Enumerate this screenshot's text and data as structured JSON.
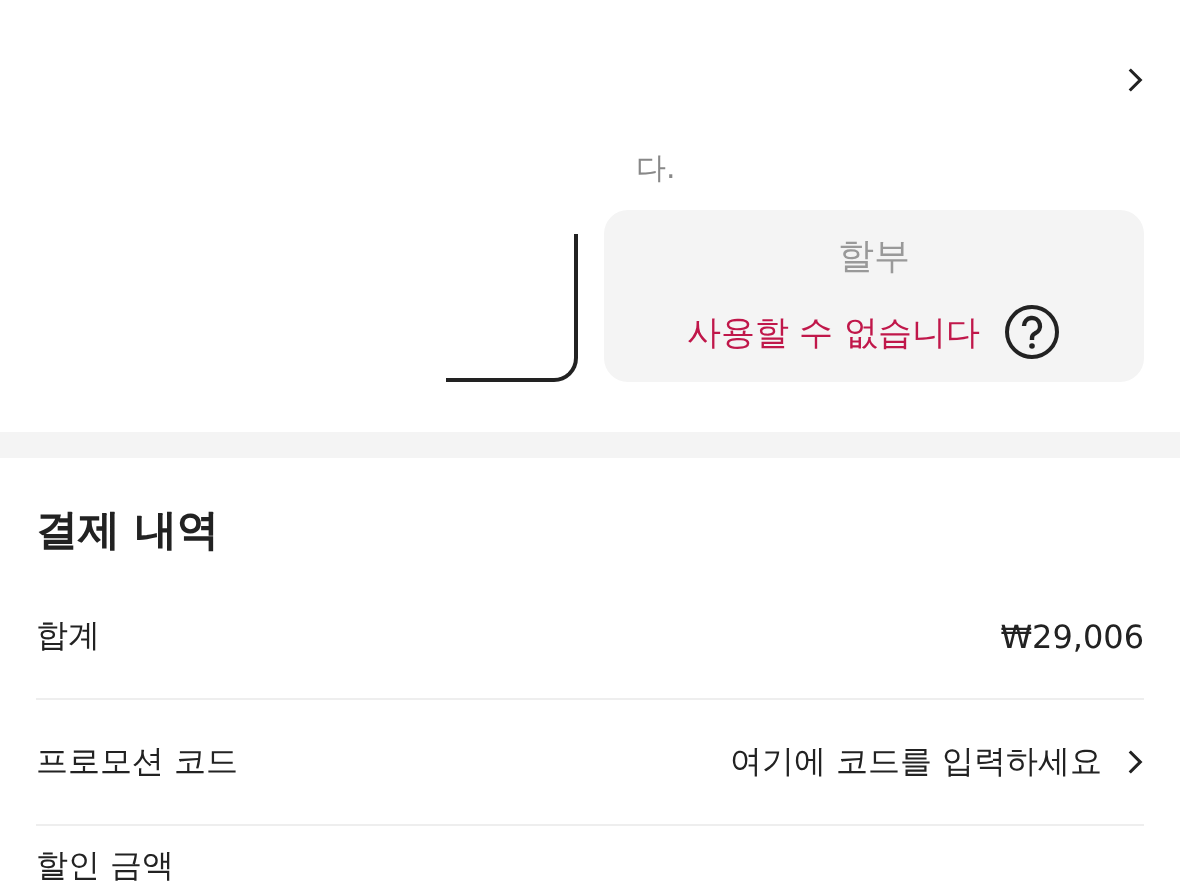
{
  "notice_text": "다.",
  "payment_options": [
    {
      "selected": true
    },
    {
      "label": "할부",
      "status": "사용할 수 없습니다",
      "selected": false
    }
  ],
  "summary": {
    "title": "결제 내역",
    "rows": [
      {
        "kind": "amount",
        "label": "합계",
        "value": "₩29,006"
      },
      {
        "kind": "link",
        "label": "프로모션 코드",
        "value": "여기에 코드를 입력하세요"
      },
      {
        "kind": "amount",
        "label": "할인 금액"
      }
    ]
  }
}
